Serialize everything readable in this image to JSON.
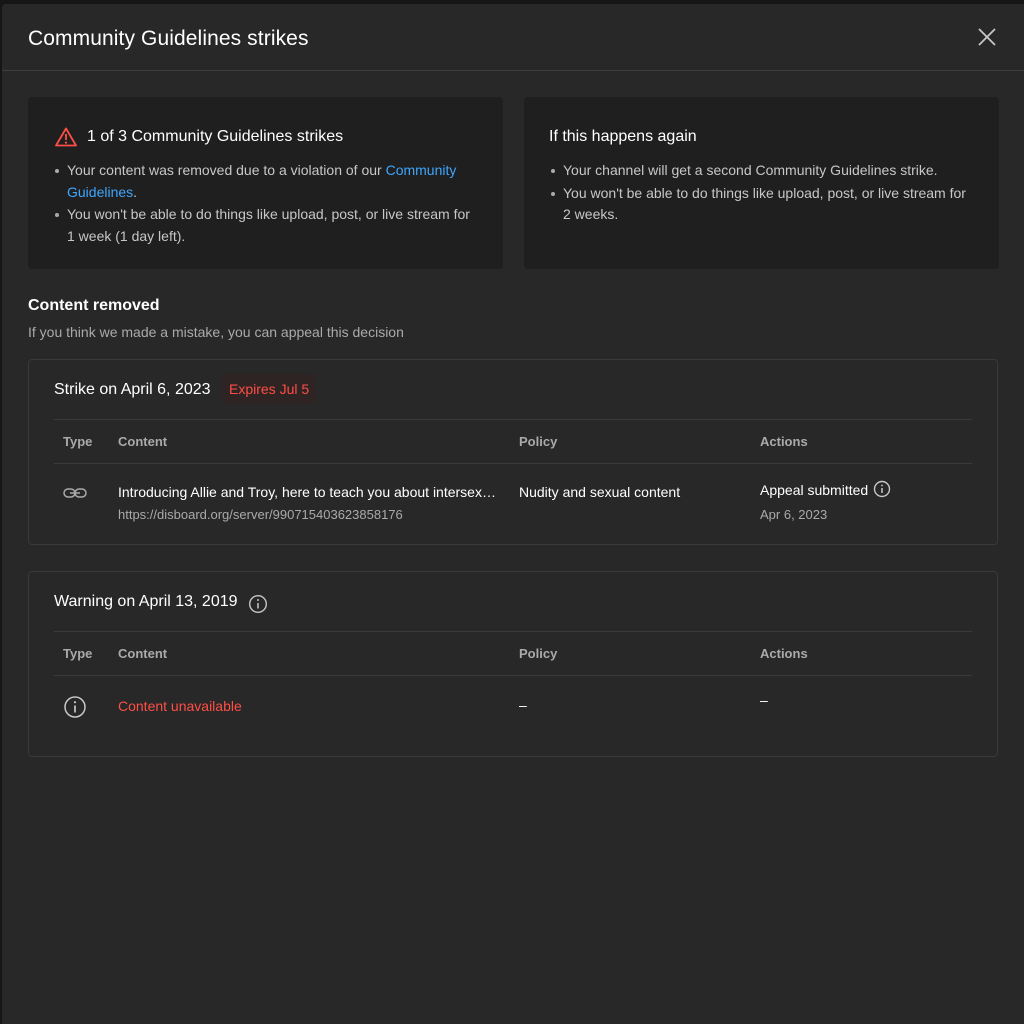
{
  "dialog": {
    "title": "Community Guidelines strikes",
    "close_icon": "close-icon"
  },
  "strike_panel": {
    "icon": "warning-triangle-icon",
    "heading": "1 of 3 Community Guidelines strikes",
    "bullet1_text": "Your content was removed due to a violation of our ",
    "bullet1_link": "Community Guidelines",
    "bullet1_end": ".",
    "bullet2": "You won't be able to do things like upload, post, or live stream for 1 week (1 day left)."
  },
  "again_panel": {
    "heading": "If this happens again",
    "bullets": [
      "Your channel will get a second Community Guidelines strike.",
      "You won't be able to do things like upload, post, or live stream for 2 weeks."
    ]
  },
  "content_removed": {
    "title": "Content removed",
    "subtitle": "If you think we made a mistake, you can appeal this decision"
  },
  "columns": {
    "type": "Type",
    "content": "Content",
    "policy": "Policy",
    "actions": "Actions"
  },
  "strike_card": {
    "title": "Strike on April 6, 2023",
    "badge": "Expires Jul 5",
    "row": {
      "type_icon": "link-icon",
      "content_title": "Introducing Allie and Troy, here to teach you about intersex, ...",
      "content_url": "https://disboard.org/server/990715403623858176",
      "policy": "Nudity and sexual content",
      "action": "Appeal submitted",
      "action_date": "Apr 6, 2023"
    }
  },
  "warning_card": {
    "title": "Warning on April 13, 2019",
    "row": {
      "type_icon": "info-circle-icon",
      "content": "Content unavailable",
      "policy": "–",
      "actions": "–"
    }
  },
  "colors": {
    "accent_link": "#3ea6ff",
    "alert_red": "#ff4e45",
    "dialog_bg": "#282828",
    "panel_bg": "#1f1f1f"
  }
}
